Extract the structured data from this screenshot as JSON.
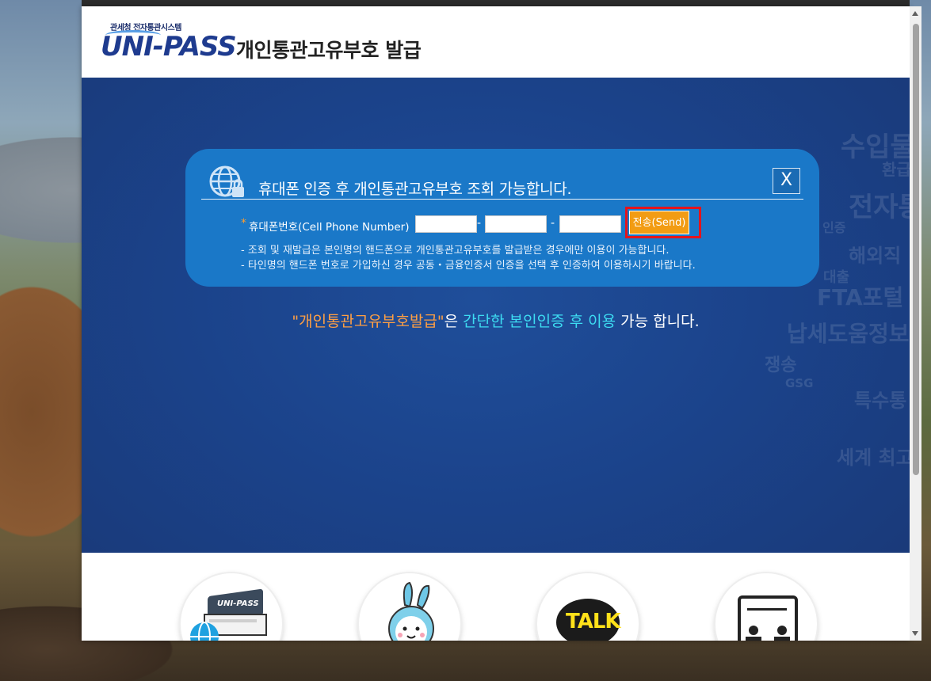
{
  "header": {
    "logo_sub": "관세청 전자통관시스템",
    "logo_main": "UNI-PASS",
    "title": "개인통관고유부호 발급"
  },
  "popup": {
    "title": "휴대폰 인증 후 개인통관고유부호 조회 가능합니다.",
    "close_label": "X",
    "required_mark": "*",
    "phone_label": "휴대폰번호(Cell Phone Number)",
    "phone_part1": "",
    "phone_part2": "",
    "phone_part3": "",
    "separator": "-",
    "send_label": "전송(Send)",
    "notes": [
      "- 조회 및 재발급은 본인명의 핸드폰으로 개인통관고유부호를 발급받은 경우에만 이용이 가능합니다.",
      "- 타인명의 핸드폰 번호로 가입하신 경우 공동・금융인증서 인증을 선택 후 인증하여 이용하시기 바랍니다."
    ]
  },
  "info": {
    "part1": "\"개인통관고유부호발급\"",
    "part2": "은 ",
    "part3": "간단한 본인인증 후 이용",
    "part4": " 가능 합니다."
  },
  "watermark": {
    "w1": "수입물",
    "w2": "환급",
    "w3": "전자통",
    "w4": "인증",
    "w5": "해외직",
    "w6": "대출",
    "w7": "FTA포털",
    "w8": "납세도움정보",
    "w9": "쟁송",
    "w10": "GSG",
    "w11": "특수통",
    "w12": "세계 최고"
  },
  "bottom_icons": {
    "icon1_text": "UNI-PASS",
    "icon3_text": "TALK"
  },
  "colors": {
    "banner": "#1b438b",
    "popup": "#1a78c8",
    "send": "#f29c13",
    "highlight": "#e4141c"
  }
}
